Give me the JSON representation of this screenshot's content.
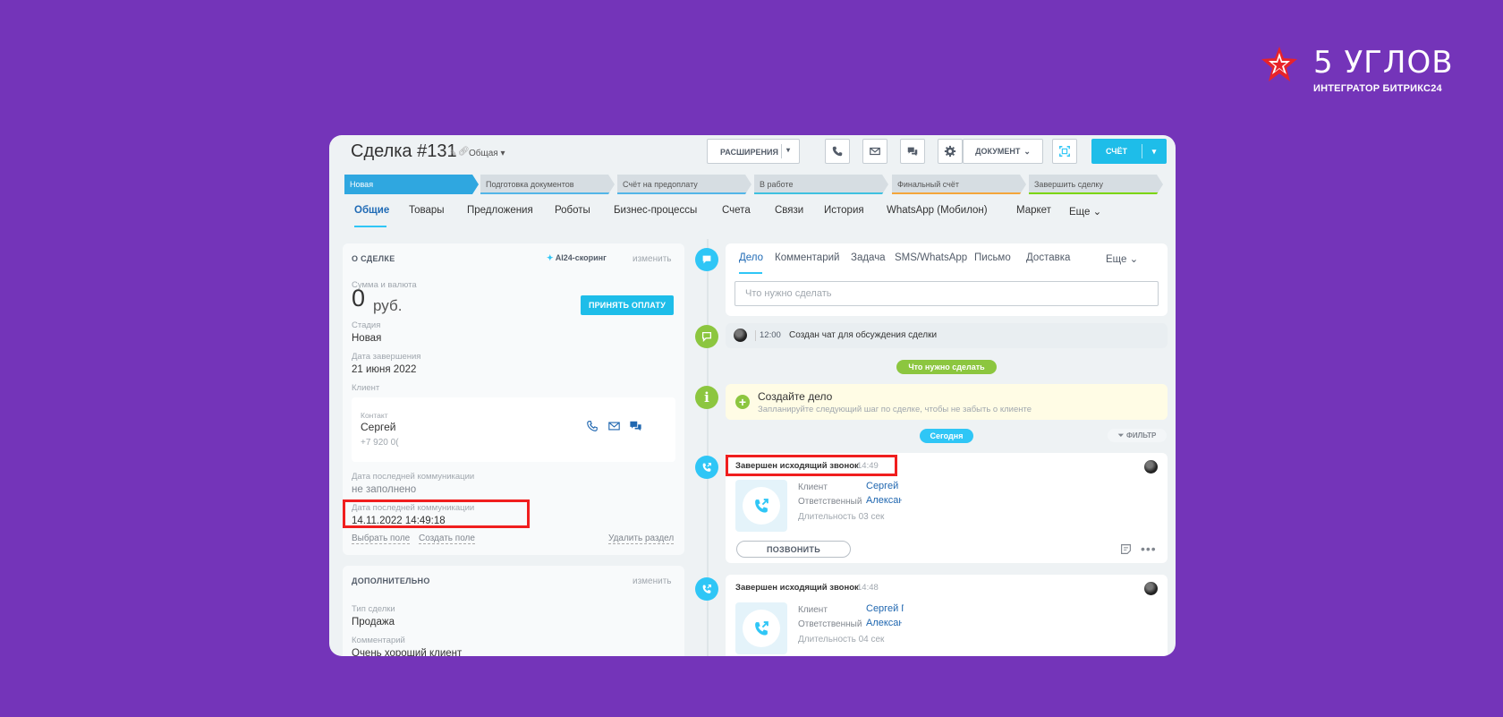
{
  "brand": {
    "title": "5 УГЛОВ",
    "subtitle": "ИНТЕГРАТОР БИТРИКС24"
  },
  "header": {
    "title": "Сделка #131",
    "category": "Общая",
    "extensions_label": "РАСШИРЕНИЯ",
    "document_label": "ДОКУМЕНТ",
    "invoice_label": "СЧЁТ"
  },
  "stages": [
    {
      "label": "Новая",
      "color": "#2fa7e0",
      "text_color": "#ffffff",
      "active": true
    },
    {
      "label": "Подготовка документов",
      "color": "#d6dde2",
      "accent": "#52b6e8"
    },
    {
      "label": "Счёт на предоплату",
      "color": "#d6dde2",
      "accent": "#52b6e8"
    },
    {
      "label": "В работе",
      "color": "#d6dde2",
      "accent": "#3ec1e0"
    },
    {
      "label": "Финальный счёт",
      "color": "#d6dde2",
      "accent": "#f4a53a"
    },
    {
      "label": "Завершить сделку",
      "color": "#d6dde2",
      "accent": "#7bd500"
    }
  ],
  "tabs": [
    {
      "label": "Общие",
      "active": true
    },
    {
      "label": "Товары"
    },
    {
      "label": "Предложения"
    },
    {
      "label": "Роботы"
    },
    {
      "label": "Бизнес-процессы"
    },
    {
      "label": "Счета"
    },
    {
      "label": "Связи"
    },
    {
      "label": "История"
    },
    {
      "label": "WhatsApp (Мобилон)"
    },
    {
      "label": "Маркет"
    },
    {
      "label": "Еще"
    }
  ],
  "about": {
    "heading": "О СДЕЛКЕ",
    "scoring": "AI24-скоринг",
    "edit": "изменить",
    "sum_label": "Сумма и валюта",
    "sum_value": "0",
    "currency": "руб.",
    "pay_button": "ПРИНЯТЬ ОПЛАТУ",
    "stage_label": "Стадия",
    "stage_value": "Новая",
    "close_date_label": "Дата завершения",
    "close_date_value": "21 июня 2022",
    "client_label": "Клиент",
    "contact_label": "Контакт",
    "contact_name": "Сергей",
    "contact_phone": "+7 920 0(",
    "last_comm_label_1": "Дата последней коммуникации",
    "last_comm_value_1": "не заполнено",
    "last_comm_label_2": "Дата последней коммуникации",
    "last_comm_value_2": "14.11.2022 14:49:18",
    "select_field": "Выбрать поле",
    "create_field": "Создать поле",
    "delete_section": "Удалить раздел"
  },
  "additional": {
    "heading": "ДОПОЛНИТЕЛЬНО",
    "edit": "изменить",
    "type_label": "Тип сделки",
    "type_value": "Продажа",
    "comment_label": "Комментарий",
    "comment_value": "Очень хороший клиент"
  },
  "activity": {
    "tabs": [
      "Дело",
      "Комментарий",
      "Задача",
      "SMS/WhatsApp",
      "Письмо",
      "Доставка"
    ],
    "more": "Еще",
    "placeholder": "Что нужно сделать"
  },
  "timeline": {
    "chat_time": "12:00",
    "chat_text": "Создан чат для обсуждения сделки",
    "todo_pill": "Что нужно сделать",
    "create_title": "Создайте дело",
    "create_hint": "Запланируйте следующий шаг по сделке, чтобы не забыть о клиенте",
    "today_pill": "Сегодня",
    "filter": "ФИЛЬТР",
    "calls": [
      {
        "title": "Завершен исходящий звонок",
        "time": "14:49",
        "client_label": "Клиент",
        "client": "Сергей",
        "responsible_label": "Ответственный",
        "responsible": "Алексан",
        "duration": "Длительность 03 сек",
        "call_button": "ПОЗВОНИТЬ"
      },
      {
        "title": "Завершен исходящий звонок",
        "time": "14:48",
        "client_label": "Клиент",
        "client": "Сергей Г",
        "responsible_label": "Ответственный",
        "responsible": "Алексан",
        "duration": "Длительность 04 сек"
      }
    ]
  },
  "colors": {
    "background": "#7434b9",
    "accent_blue": "#1ebde9",
    "accent_green": "#8cc63f",
    "highlight_red": "#f01e1e"
  }
}
